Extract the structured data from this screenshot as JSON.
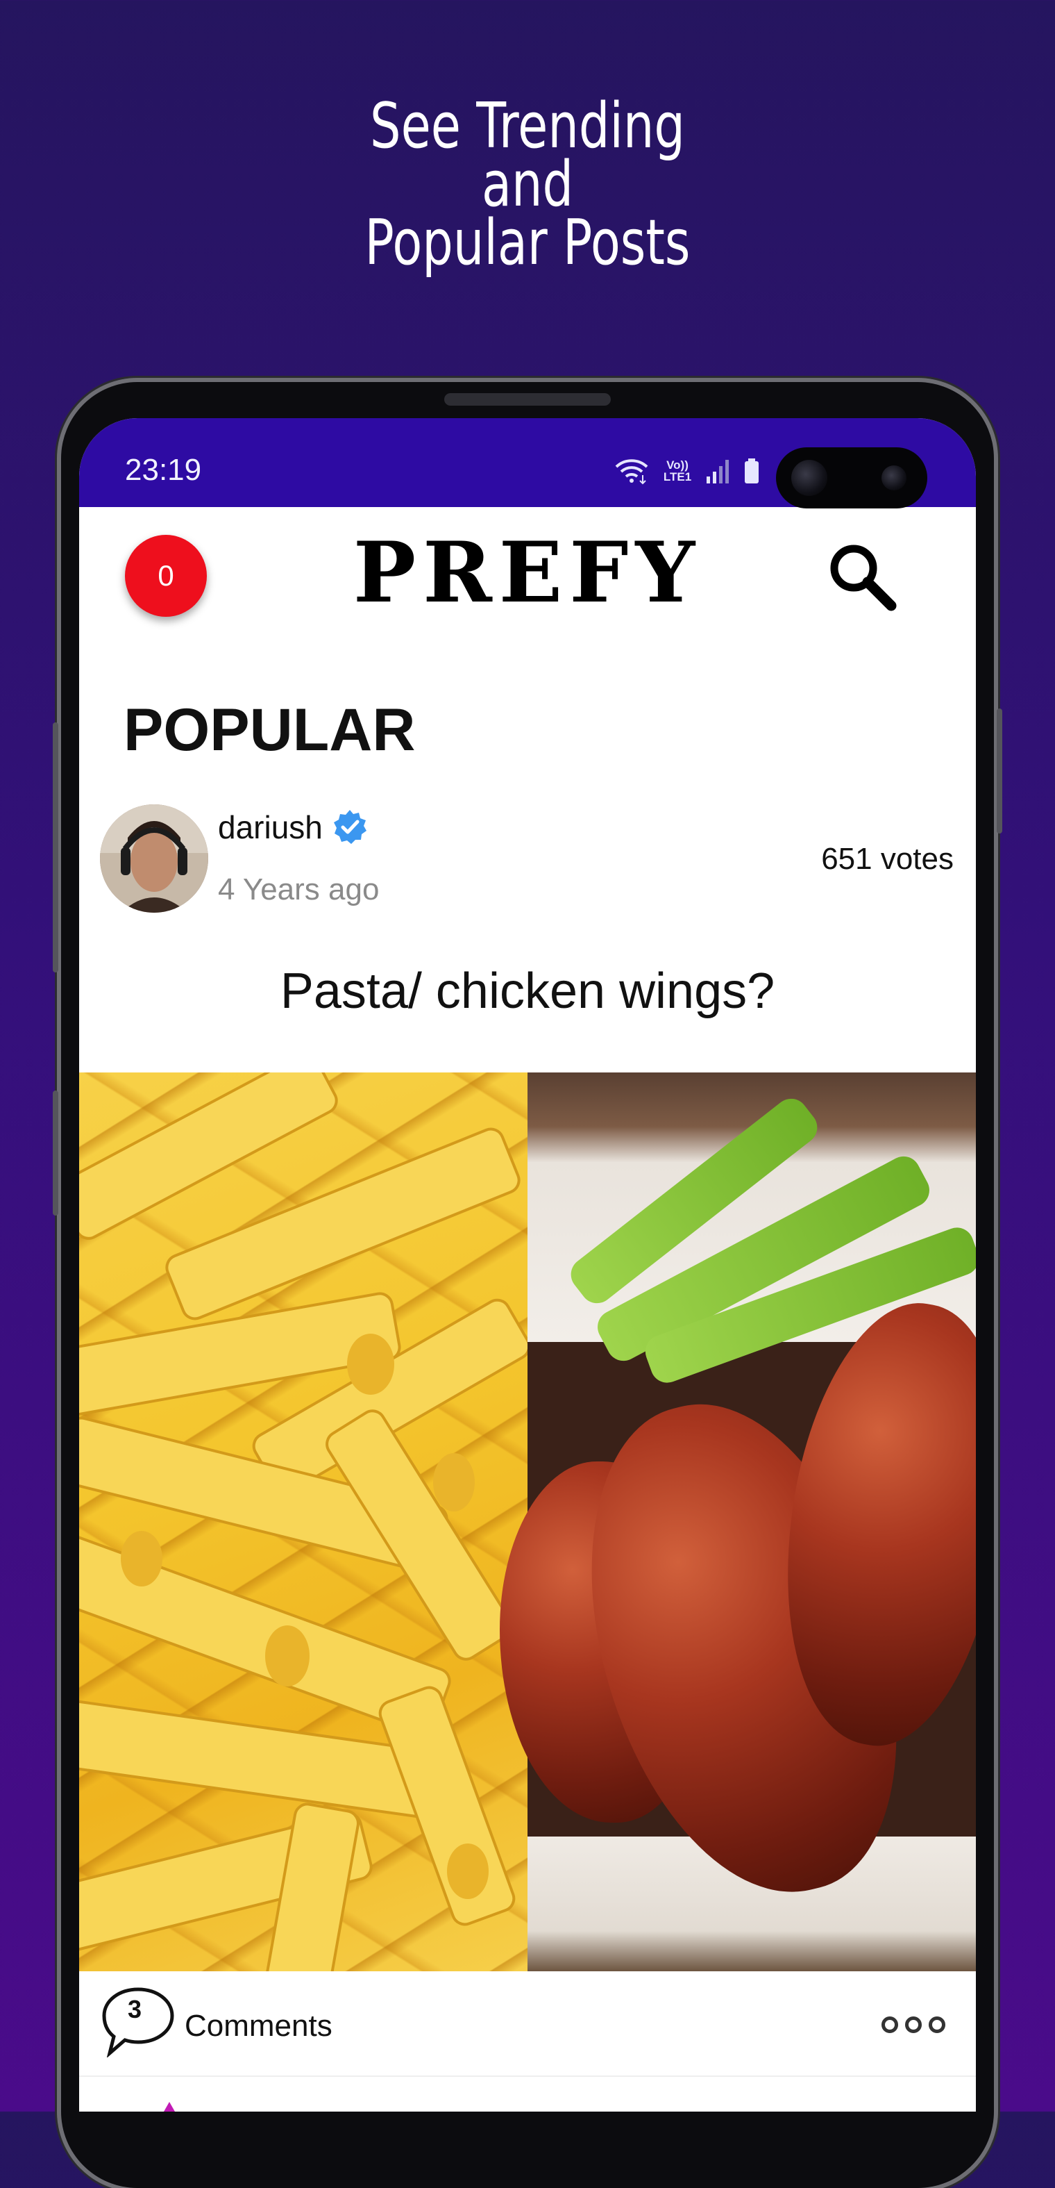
{
  "promo": {
    "line1": "See Trending",
    "line2": "and",
    "line3": "Popular Posts"
  },
  "status_bar": {
    "time": "23:19",
    "network": "Vo)) LTE1"
  },
  "header": {
    "notification_count": "0",
    "app_name": "PREFY"
  },
  "section_title": "POPULAR",
  "post": {
    "username": "dariush",
    "verified": true,
    "time_ago": "4 Years ago",
    "votes": "651 votes",
    "question": "Pasta/ chicken wings?",
    "options": [
      "pasta-image",
      "chicken-wings-image"
    ],
    "comment_count": "3",
    "comments_label": "Comments"
  },
  "colors": {
    "status_bar": "#2e0ba3",
    "badge": "#ee0f1d",
    "verified": "#3b97f0",
    "background_top": "#25155f",
    "background_bottom": "#4a0b8a"
  }
}
